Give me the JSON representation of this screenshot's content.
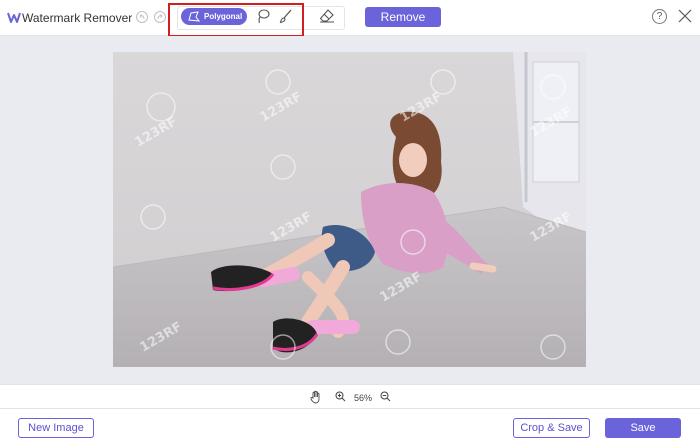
{
  "app": {
    "title": "Watermark Remover"
  },
  "toolbar": {
    "polygonal_label": "Polygonal",
    "remove_label": "Remove",
    "help_label": "?"
  },
  "zoom": {
    "level": "56%"
  },
  "photo": {
    "watermark_text": "123RF"
  },
  "footer": {
    "new_image_label": "New Image",
    "crop_save_label": "Crop & Save",
    "save_label": "Save"
  },
  "colors": {
    "accent": "#6b63d9",
    "highlight": "#d11f1f",
    "canvas": "#eaebf0"
  },
  "icons": [
    "logo-icon",
    "undo-icon",
    "redo-icon",
    "polygon-icon",
    "lasso-icon",
    "brush-icon",
    "eraser-icon",
    "help-icon",
    "close-icon",
    "hand-icon",
    "zoom-in-icon",
    "zoom-out-icon"
  ]
}
